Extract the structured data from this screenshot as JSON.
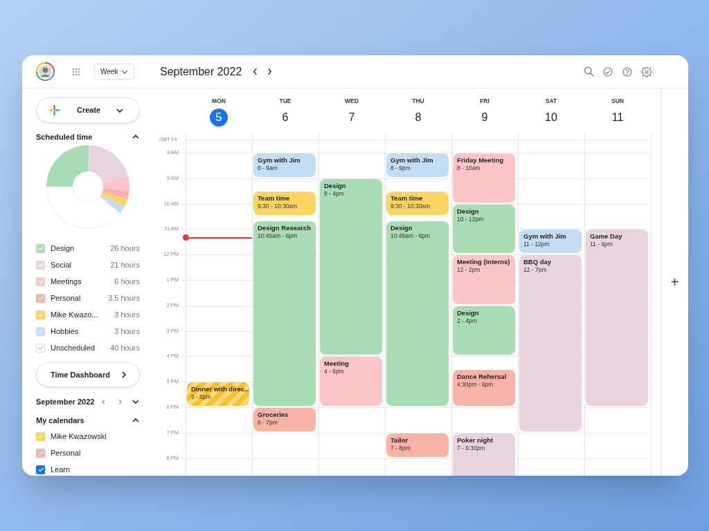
{
  "header": {
    "view": "Week",
    "title": "September 2022"
  },
  "create_button": "Create",
  "scheduled_time": {
    "title": "Scheduled time",
    "expanded": true,
    "chart_data": {
      "type": "donut",
      "values": [
        25.37,
        20.49,
        5.85,
        3.41,
        2.93,
        2.93,
        39.02
      ]
    },
    "categories": [
      {
        "label": "Design",
        "hours": "26 hours",
        "color": "#a8dcb3",
        "checked": true
      },
      {
        "label": "Social",
        "hours": "21 hours",
        "color": "#e8d4e0",
        "checked": true
      },
      {
        "label": "Meetings",
        "hours": "6 hours",
        "color": "#fcc5c7",
        "checked": true
      },
      {
        "label": "Personal",
        "hours": "3.5 hours",
        "color": "#f8b3a6",
        "checked": true
      },
      {
        "label": "Mike Kwazo...",
        "hours": "3 hours",
        "color": "#fcd462",
        "checked": true
      },
      {
        "label": "Hobbies",
        "hours": "3 hours",
        "color": "#c2ddf6",
        "checked": true
      },
      {
        "label": "Unscheduled",
        "hours": "40 hours",
        "color": "#ffffff",
        "checked": true
      }
    ]
  },
  "time_dashboard_button": "Time Dashboard",
  "mini_calendar": {
    "title": "September 2022",
    "expanded": false
  },
  "my_calendars": {
    "title": "My calendars",
    "expanded": true,
    "items": [
      {
        "label": "Mike Kwazowski",
        "color": "#fcd462",
        "checked": true
      },
      {
        "label": "Personal",
        "color": "#f8b3a6",
        "checked": true
      },
      {
        "label": "Learn",
        "color": "#1a73e8",
        "checked": true
      }
    ]
  },
  "timezone": "GMT-04",
  "hours": [
    "8 AM",
    "9 AM",
    "10 AM",
    "11 AM",
    "12 PM",
    "1 PM",
    "2 PM",
    "3 PM",
    "4 PM",
    "5 PM",
    "6 PM",
    "7 PM",
    "8 PM"
  ],
  "days": [
    {
      "name": "MON",
      "date": "5",
      "selected": true,
      "events": [
        {
          "title": "Dinner with direc..",
          "time": "5 - 6pm",
          "color": "#f9bf26",
          "striped": true
        }
      ]
    },
    {
      "name": "TUE",
      "date": "6",
      "selected": false,
      "events": [
        {
          "title": "Gym with Jim",
          "time": "8 - 9am",
          "color": "#c2ddf6",
          "striped": false
        },
        {
          "title": "Team time",
          "time": "9:30 - 10:30am",
          "color": "#fcd462",
          "striped": false
        },
        {
          "title": "Design Research",
          "time": "10:45am - 6pm",
          "color": "#a8dcb3",
          "striped": false
        },
        {
          "title": "Groceries",
          "time": "6 - 7pm",
          "color": "#f8b3a6",
          "striped": false
        }
      ]
    },
    {
      "name": "WED",
      "date": "7",
      "selected": false,
      "events": [
        {
          "title": "Design",
          "time": "9 - 4pm",
          "color": "#a8dcb3",
          "striped": false
        },
        {
          "title": "Meeting",
          "time": "4 - 6pm",
          "color": "#fcc5c7",
          "striped": false
        }
      ]
    },
    {
      "name": "THU",
      "date": "8",
      "selected": false,
      "events": [
        {
          "title": "Gym with Jim",
          "time": "8 - 9pm",
          "color": "#c2ddf6",
          "striped": false
        },
        {
          "title": "Team time",
          "time": "9:30 - 10:30am",
          "color": "#fcd462",
          "striped": false
        },
        {
          "title": "Design",
          "time": "10:45am - 6pm",
          "color": "#a8dcb3",
          "striped": false
        },
        {
          "title": "Tailor",
          "time": "7 - 8pm",
          "color": "#f8b3a6",
          "striped": false
        }
      ]
    },
    {
      "name": "FRI",
      "date": "9",
      "selected": false,
      "events": [
        {
          "title": "Friday Meeting",
          "time": "8 - 10am",
          "color": "#fcc5c7",
          "striped": false
        },
        {
          "title": "Design",
          "time": "10 - 12pm",
          "color": "#a8dcb3",
          "striped": false
        },
        {
          "title": "Meeting (Interns)",
          "time": "12 - 2pm",
          "color": "#fcc5c7",
          "striped": false
        },
        {
          "title": "Design",
          "time": "2 - 4pm",
          "color": "#a8dcb3",
          "striped": false
        },
        {
          "title": "Dance Rehersal",
          "time": "4:30pm - 6pm",
          "color": "#f8b3a6",
          "striped": false
        },
        {
          "title": "Poker night",
          "time": "7 - 9:30pm",
          "color": "#e8d4e0",
          "striped": false
        }
      ]
    },
    {
      "name": "SAT",
      "date": "10",
      "selected": false,
      "events": [
        {
          "title": "Gym with Jim",
          "time": "11 - 12pm",
          "color": "#c2ddf6",
          "striped": false
        },
        {
          "title": "BBQ day",
          "time": "12 - 7pm",
          "color": "#e8d4e0",
          "striped": false
        }
      ]
    },
    {
      "name": "SUN",
      "date": "11",
      "selected": false,
      "events": [
        {
          "title": "Game Day",
          "time": "11 - 6pm",
          "color": "#e8d4e0",
          "striped": false
        }
      ]
    }
  ],
  "add_button": "+"
}
